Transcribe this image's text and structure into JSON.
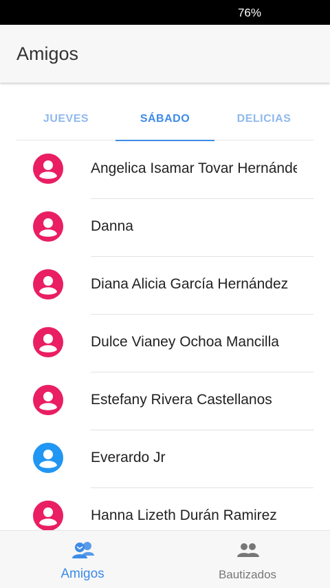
{
  "status_bar": {
    "battery": "76%"
  },
  "app_bar": {
    "title": "Amigos"
  },
  "tabs": [
    {
      "label": "JUEVES"
    },
    {
      "label": "SÁBADO"
    },
    {
      "label": "DELICIAS"
    }
  ],
  "active_tab": "SÁBADO",
  "friends": [
    {
      "name": "Angelica Isamar Tovar Hernández",
      "avatar_color": "#e91e63"
    },
    {
      "name": "Danna",
      "avatar_color": "#e91e63"
    },
    {
      "name": "Diana Alicia García Hernández",
      "avatar_color": "#e91e63"
    },
    {
      "name": "Dulce Vianey Ochoa Mancilla",
      "avatar_color": "#e91e63"
    },
    {
      "name": "Estefany Rivera Castellanos",
      "avatar_color": "#e91e63"
    },
    {
      "name": "Everardo Jr",
      "avatar_color": "#2196f3"
    },
    {
      "name": "Hanna Lizeth Durán Ramirez",
      "avatar_color": "#e91e63"
    }
  ],
  "bottom_nav": {
    "amigos_label": "Amigos",
    "bautizados_label": "Bautizados"
  },
  "colors": {
    "accent": "#3d8be8",
    "female_avatar": "#e91e63",
    "male_avatar": "#2196f3",
    "inactive_icon": "#777777"
  },
  "icons": {
    "avatar": "account-circle-icon",
    "amigos": "friends-chat-icon",
    "bautizados": "people-icon"
  }
}
